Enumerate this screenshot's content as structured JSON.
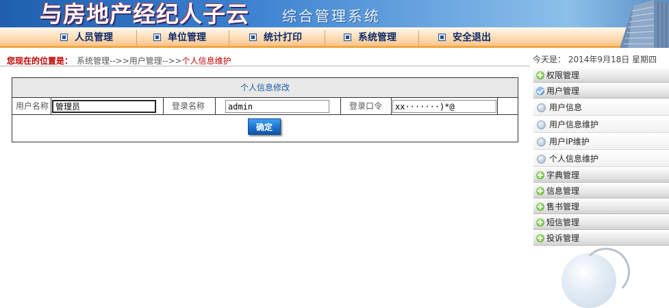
{
  "header": {
    "title": "与房地产经纪人子云",
    "subtitle": "综合管理系统"
  },
  "nav": {
    "items": [
      {
        "label": "人员管理"
      },
      {
        "label": "单位管理"
      },
      {
        "label": "统计打印"
      },
      {
        "label": "系统管理"
      },
      {
        "label": "安全退出"
      }
    ]
  },
  "breadcrumb": {
    "label": "您现在的位置是：",
    "path": "系统管理-->>用户管理-->>",
    "current": "个人信息维护"
  },
  "date": {
    "text": "今天是： 2014年9月18日 星期四"
  },
  "form": {
    "title": "个人信息修改",
    "username_label": "用户名称",
    "username_value": "管理员",
    "login_label": "登录名称",
    "login_value": "admin",
    "password_label": "登录口令",
    "password_value": "xx·······)*@",
    "confirm_label": "确定"
  },
  "sidebar": {
    "items": [
      {
        "label": "权限管理",
        "icon": "plus-circle-icon"
      },
      {
        "label": "用户管理",
        "icon": "check-circle-icon",
        "expanded": true,
        "children": [
          {
            "label": "用户信息"
          },
          {
            "label": "用户信息维护"
          },
          {
            "label": "用户IP维护"
          },
          {
            "label": "个人信息维护"
          }
        ]
      },
      {
        "label": "字典管理",
        "icon": "plus-circle-icon"
      },
      {
        "label": "信息管理",
        "icon": "plus-circle-icon"
      },
      {
        "label": "售书管理",
        "icon": "plus-circle-icon"
      },
      {
        "label": "短信管理",
        "icon": "plus-circle-icon"
      },
      {
        "label": "投诉管理",
        "icon": "plus-circle-icon"
      }
    ]
  },
  "colors": {
    "accent_blue": "#1a5fa8",
    "breadcrumb_red": "#c00000",
    "nav_orange": "#f4a63c"
  }
}
